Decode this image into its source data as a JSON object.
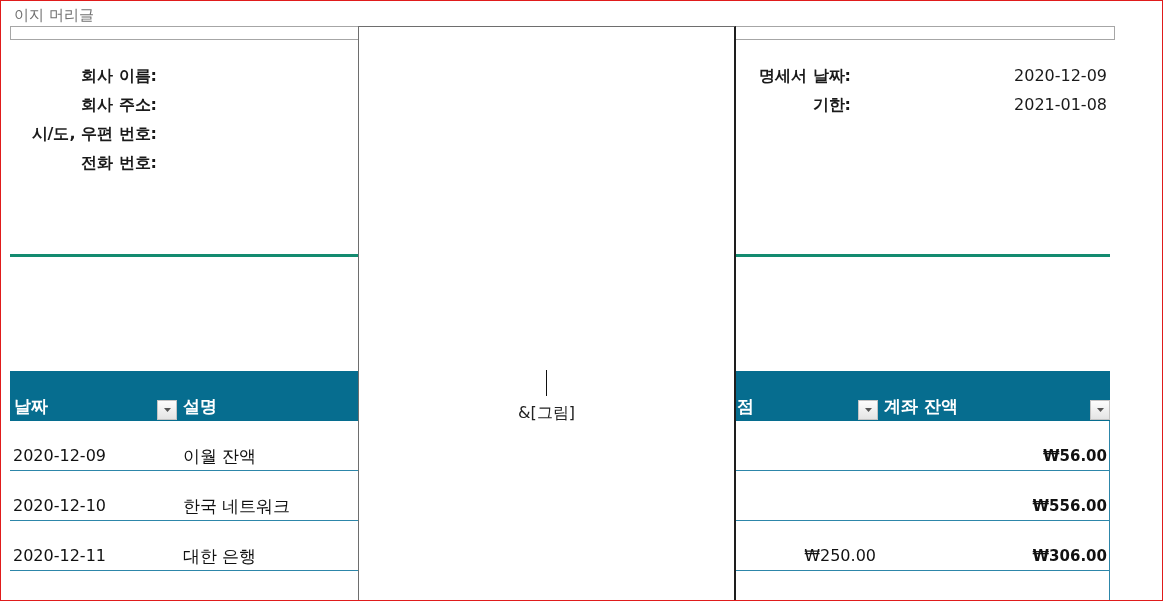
{
  "header_label": "이지 머리글",
  "picture_box": {
    "field_code": "&[그림]"
  },
  "company_labels": [
    "회사 이름:",
    "회사 주소:",
    "시/도, 우편 번호:",
    "전화 번호:"
  ],
  "statement_info": [
    {
      "label": "명세서 날짜:",
      "value": "2020-12-09"
    },
    {
      "label": "기한:",
      "value": "2021-01-08"
    }
  ],
  "table": {
    "columns": [
      {
        "label": "날짜",
        "filter": true
      },
      {
        "label": "설명",
        "filter": false
      },
      {
        "label": "점",
        "filter": true
      },
      {
        "label": "계좌 잔액",
        "filter": true
      }
    ],
    "rows": [
      {
        "date": "2020-12-09",
        "description": "이월 잔액",
        "balance": "₩56.00"
      },
      {
        "date": "2020-12-10",
        "description": "한국 네트워크",
        "balance": "₩556.00"
      },
      {
        "date": "2020-12-11",
        "description": "대한 은행",
        "column_3": "₩250.00",
        "balance": "₩306.00"
      }
    ]
  }
}
